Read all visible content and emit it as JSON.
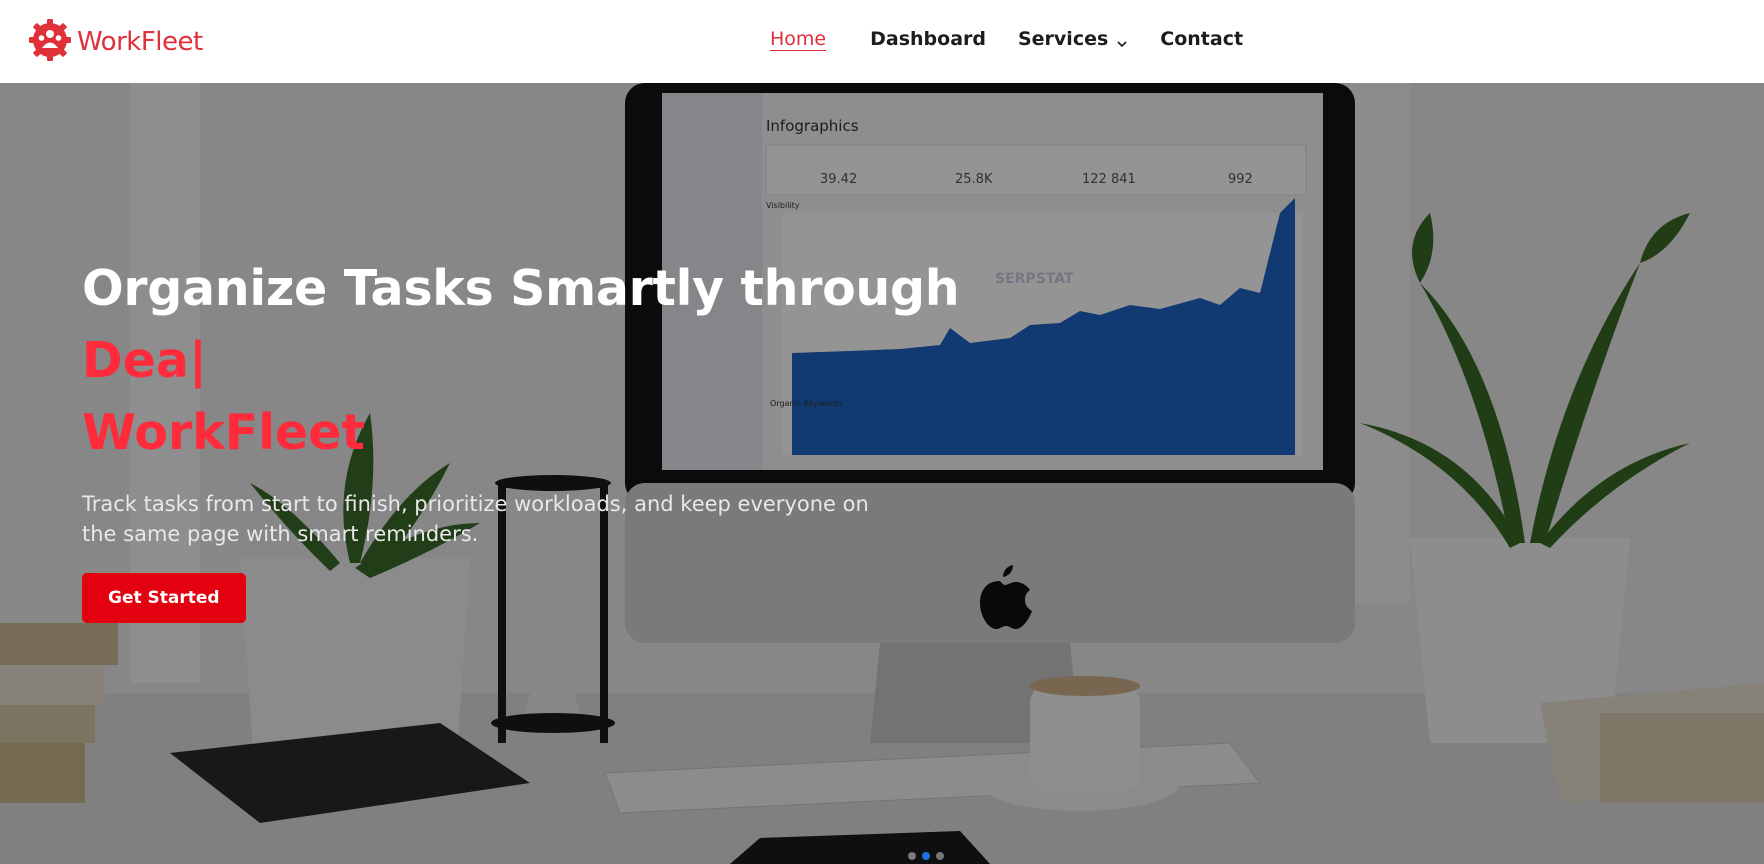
{
  "brand": {
    "name": "WorkFleet",
    "color": "#e0303a",
    "logo_icon": "team-gear-icon"
  },
  "nav": {
    "items": [
      {
        "label": "Home",
        "active": true
      },
      {
        "label": "Dashboard",
        "active": false
      },
      {
        "label": "Services",
        "active": false,
        "icon": "chevron-down-icon"
      },
      {
        "label": "Contact",
        "active": false
      }
    ]
  },
  "hero": {
    "title": "Organize Tasks Smartly through",
    "typed_text": "Dea|",
    "brand_line": "WorkFleet",
    "description": "Track tasks from start to finish, prioritize workloads, and keep everyone on the same page with smart reminders.",
    "cta_label": "Get Started",
    "slides": {
      "count": 3,
      "active_index": 1
    }
  },
  "background_screen": {
    "title": "Infographics",
    "section": "Visibility",
    "metrics": [
      "39.42",
      "25.8K",
      "122 841",
      "992"
    ],
    "watermark": "SERPSTAT",
    "keywords_label": "Organic Keywords"
  },
  "colors": {
    "accent": "#e3000f",
    "typed": "#ff2a3a",
    "active_dot": "#1a73e8"
  }
}
